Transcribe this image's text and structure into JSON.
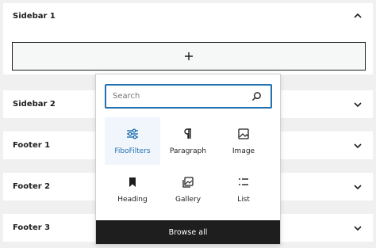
{
  "panels": [
    {
      "title": "Sidebar 1",
      "expanded": true
    },
    {
      "title": "Sidebar 2",
      "expanded": false
    },
    {
      "title": "Footer 1",
      "expanded": false
    },
    {
      "title": "Footer 2",
      "expanded": false
    },
    {
      "title": "Footer 3",
      "expanded": false
    }
  ],
  "appender": {
    "icon": "plus-icon"
  },
  "inserter": {
    "search": {
      "placeholder": "Search",
      "value": ""
    },
    "blocks": [
      {
        "label": "FiboFilters",
        "icon": "sliders-icon",
        "active": true
      },
      {
        "label": "Paragraph",
        "icon": "pilcrow-icon",
        "active": false
      },
      {
        "label": "Image",
        "icon": "image-icon",
        "active": false
      },
      {
        "label": "Heading",
        "icon": "bookmark-icon",
        "active": false
      },
      {
        "label": "Gallery",
        "icon": "gallery-icon",
        "active": false
      },
      {
        "label": "List",
        "icon": "list-icon",
        "active": false
      }
    ],
    "browse_all": "Browse all"
  },
  "colors": {
    "accent": "#2271b1",
    "dark": "#1e1e1e",
    "background": "#f0f0f1"
  }
}
